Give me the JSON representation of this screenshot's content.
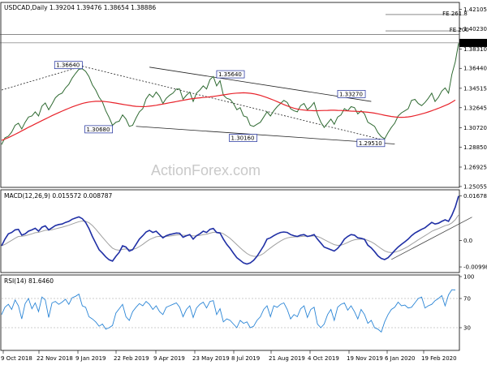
{
  "chart_data": {
    "type": "line",
    "watermark": "ActionForex.com",
    "dates": [
      "9 Oct 2018",
      "22 Nov 2018",
      "9 Jan 2019",
      "22 Feb 2019",
      "9 Apr 2019",
      "23 May 2019",
      "8 Jul 2019",
      "21 Aug 2019",
      "4 Oct 2019",
      "19 Nov 2019",
      "6 Jan 2020",
      "19 Feb 2020"
    ],
    "price": {
      "header": "USDCAD,Daily  1.39204 1.39476 1.38654 1.38886",
      "ylim": [
        1.2505,
        1.4271
      ],
      "yticks": [
        "1.42105",
        "1.40230",
        "1.38310",
        "1.36440",
        "1.34515",
        "1.32645",
        "1.30720",
        "1.28850",
        "1.26925",
        "1.25055"
      ],
      "last_price": "1.38886",
      "series": [
        {
          "values": [
            1.291,
            1.2975,
            1.299,
            1.303,
            1.3095,
            1.3115,
            1.306,
            1.3125,
            1.3175,
            1.3185,
            1.3225,
            1.3185,
            1.328,
            1.331,
            1.3245,
            1.33,
            1.336,
            1.339,
            1.3405,
            1.3455,
            1.349,
            1.355,
            1.3595,
            1.3635,
            1.364,
            1.3615,
            1.3565,
            1.3485,
            1.3435,
            1.3365,
            1.332,
            1.3235,
            1.317,
            1.3095,
            1.3125,
            1.3135,
            1.3195,
            1.3155,
            1.3085,
            1.3095,
            1.3165,
            1.3225,
            1.3255,
            1.335,
            1.3395,
            1.3365,
            1.3415,
            1.3375,
            1.3305,
            1.3355,
            1.3385,
            1.3405,
            1.3445,
            1.3445,
            1.3345,
            1.3385,
            1.3415,
            1.3325,
            1.3405,
            1.3435,
            1.3475,
            1.3445,
            1.3535,
            1.3565,
            1.3475,
            1.3525,
            1.3385,
            1.3355,
            1.3345,
            1.3305,
            1.3245,
            1.3265,
            1.3185,
            1.3175,
            1.3095,
            1.3085,
            1.3105,
            1.3125,
            1.3175,
            1.3225,
            1.3185,
            1.3235,
            1.3275,
            1.3305,
            1.3335,
            1.3315,
            1.3255,
            1.3235,
            1.3225,
            1.3285,
            1.3305,
            1.3245,
            1.3275,
            1.3315,
            1.3205,
            1.3125,
            1.3075,
            1.3115,
            1.3155,
            1.3105,
            1.3175,
            1.3195,
            1.3255,
            1.3235,
            1.3275,
            1.3265,
            1.3205,
            1.3235,
            1.3205,
            1.3125,
            1.3105,
            1.3085,
            1.3025,
            1.2985,
            1.2965,
            1.3025,
            1.3075,
            1.3115,
            1.3185,
            1.3215,
            1.3235,
            1.3255,
            1.3335,
            1.3345,
            1.3305,
            1.3285,
            1.3315,
            1.3355,
            1.3405,
            1.3325,
            1.3365,
            1.3425,
            1.3455,
            1.3405,
            1.3585,
            1.3705,
            1.3885
          ],
          "color": "#2f6a32",
          "kind": "price"
        },
        {
          "values": [
            1.295,
            1.2962,
            1.2976,
            1.2992,
            1.3008,
            1.3024,
            1.3042,
            1.3058,
            1.3076,
            1.3092,
            1.3108,
            1.3124,
            1.314,
            1.3156,
            1.3172,
            1.3188,
            1.3203,
            1.3218,
            1.3232,
            1.3246,
            1.3259,
            1.3272,
            1.3284,
            1.3295,
            1.3305,
            1.3313,
            1.3319,
            1.3323,
            1.3326,
            1.3327,
            1.3326,
            1.3323,
            1.3319,
            1.3314,
            1.3309,
            1.3303,
            1.3297,
            1.3292,
            1.3287,
            1.3282,
            1.3278,
            1.3276,
            1.3275,
            1.3276,
            1.3279,
            1.3283,
            1.3288,
            1.3294,
            1.33,
            1.3306,
            1.3312,
            1.3318,
            1.3324,
            1.333,
            1.3336,
            1.3342,
            1.3348,
            1.3353,
            1.3357,
            1.336,
            1.3363,
            1.3366,
            1.3369,
            1.3373,
            1.3378,
            1.3383,
            1.3388,
            1.3393,
            1.3398,
            1.3402,
            1.3405,
            1.3407,
            1.3408,
            1.3407,
            1.3404,
            1.3399,
            1.3392,
            1.3383,
            1.3373,
            1.3362,
            1.335,
            1.3337,
            1.3323,
            1.3309,
            1.3295,
            1.3282,
            1.327,
            1.326,
            1.3252,
            1.3246,
            1.3242,
            1.3239,
            1.3237,
            1.3236,
            1.3236,
            1.3237,
            1.3238,
            1.3239,
            1.324,
            1.324,
            1.3239,
            1.3238,
            1.3236,
            1.3234,
            1.3232,
            1.3231,
            1.3229,
            1.3227,
            1.3224,
            1.3221,
            1.3217,
            1.3212,
            1.3206,
            1.3199,
            1.3192,
            1.3186,
            1.318,
            1.3176,
            1.3173,
            1.3172,
            1.3173,
            1.3176,
            1.3181,
            1.3188,
            1.3196,
            1.3205,
            1.3214,
            1.3224,
            1.3235,
            1.3247,
            1.3259,
            1.3272,
            1.3286,
            1.33,
            1.3318,
            1.3338
          ],
          "color": "#e8232b",
          "kind": "ma"
        }
      ],
      "annotations": [
        {
          "text": "1.36640",
          "x": 24,
          "y": 1.3664,
          "side": "left"
        },
        {
          "text": "1.30680",
          "x": 33,
          "y": 1.3045,
          "side": "left"
        },
        {
          "text": "1.35640",
          "x": 64,
          "y": 1.3575,
          "side": "right"
        },
        {
          "text": "1.30160",
          "x": 76,
          "y": 1.2962,
          "side": "left"
        },
        {
          "text": "1.33270",
          "x": 100,
          "y": 1.3385,
          "side": "right"
        },
        {
          "text": "1.29510",
          "x": 114,
          "y": 1.2913,
          "side": "left"
        },
        {
          "text": "FE 261.8",
          "x": 140,
          "y": 1.4162,
          "side": "left",
          "plain": true
        },
        {
          "text": "FE 200",
          "x": 140,
          "y": 1.4005,
          "side": "left",
          "plain": true
        }
      ],
      "hlines": [
        1.4162,
        1.4005,
        1.3972,
        1.3889
      ],
      "trendlines": [
        {
          "x1": 0,
          "y1": 1.3435,
          "x2": 24,
          "y2": 1.3664,
          "dash": true
        },
        {
          "x1": 24,
          "y1": 1.3664,
          "x2": 114,
          "y2": 1.2951,
          "dash": true
        },
        {
          "x1": 44,
          "y1": 1.3655,
          "x2": 110,
          "y2": 1.3325,
          "dash": false
        },
        {
          "x1": 40,
          "y1": 1.3085,
          "x2": 117,
          "y2": 1.2915,
          "dash": false
        }
      ]
    },
    "macd": {
      "header": "MACD(12,26,9) 0.015572 0.008787",
      "ylim": [
        -0.0115,
        0.0185
      ],
      "yticks": [
        "0.016789",
        "0.0",
        "-0.009989"
      ],
      "macd_values": [
        -0.002,
        0.0005,
        0.0025,
        0.003,
        0.004,
        0.0042,
        0.002,
        0.0025,
        0.0035,
        0.004,
        0.0046,
        0.0035,
        0.005,
        0.0055,
        0.004,
        0.0048,
        0.0056,
        0.006,
        0.0062,
        0.0068,
        0.0072,
        0.008,
        0.0085,
        0.0089,
        0.0082,
        0.0068,
        0.0045,
        0.0015,
        -0.001,
        -0.0035,
        -0.0048,
        -0.0062,
        -0.0073,
        -0.0078,
        -0.006,
        -0.0045,
        -0.002,
        -0.0025,
        -0.004,
        -0.0035,
        -0.0015,
        0.0005,
        0.0018,
        0.0032,
        0.0038,
        0.003,
        0.0035,
        0.0022,
        0.001,
        0.0018,
        0.0022,
        0.0025,
        0.0028,
        0.0027,
        0.0012,
        0.0018,
        0.0022,
        0.0005,
        0.0018,
        0.0025,
        0.0035,
        0.003,
        0.0042,
        0.0045,
        0.003,
        0.0028,
        0.0005,
        -0.0015,
        -0.003,
        -0.0048,
        -0.0065,
        -0.0075,
        -0.0085,
        -0.0089,
        -0.0085,
        -0.0075,
        -0.006,
        -0.004,
        -0.002,
        0.0005,
        0.001,
        0.0018,
        0.0025,
        0.003,
        0.0032,
        0.003,
        0.0022,
        0.0018,
        0.0015,
        0.002,
        0.0022,
        0.0015,
        0.0018,
        0.0022,
        0.0005,
        -0.001,
        -0.0025,
        -0.003,
        -0.0035,
        -0.004,
        -0.003,
        -0.0015,
        0.0005,
        0.0015,
        0.0022,
        0.002,
        0.001,
        0.0008,
        0.0004,
        -0.0018,
        -0.0028,
        -0.0042,
        -0.0058,
        -0.0068,
        -0.0072,
        -0.0065,
        -0.0052,
        -0.0038,
        -0.0025,
        -0.0015,
        -0.0005,
        0.0005,
        0.0018,
        0.0028,
        0.0035,
        0.0042,
        0.0048,
        0.0058,
        0.0068,
        0.0062,
        0.0065,
        0.0072,
        0.0078,
        0.0072,
        0.0095,
        0.0126,
        0.016789
      ],
      "colors": {
        "macd": "#1f2fa5",
        "signal": "#a0a0a0",
        "trend": "#444444"
      },
      "trendline": {
        "x1": 116,
        "y1": -0.0072,
        "x2": 140,
        "y2": 0.0088
      }
    },
    "rsi": {
      "header": "RSI(14) 81.6460",
      "ylim": [
        0,
        100
      ],
      "yticks": [
        "100",
        "70",
        "30",
        "0"
      ],
      "values": [
        48,
        58,
        62,
        55,
        68,
        60,
        42,
        63,
        70,
        56,
        64,
        52,
        72,
        68,
        44,
        64,
        66,
        62,
        65,
        69,
        62,
        71,
        73,
        76,
        60,
        58,
        45,
        42,
        38,
        32,
        35,
        28,
        30,
        33,
        50,
        56,
        62,
        45,
        40,
        52,
        58,
        63,
        60,
        66,
        62,
        55,
        60,
        52,
        48,
        58,
        60,
        62,
        64,
        58,
        45,
        55,
        60,
        44,
        57,
        62,
        65,
        57,
        66,
        67,
        48,
        56,
        38,
        42,
        40,
        35,
        30,
        40,
        36,
        38,
        30,
        32,
        40,
        45,
        55,
        60,
        45,
        60,
        58,
        62,
        64,
        55,
        42,
        48,
        45,
        56,
        60,
        44,
        55,
        58,
        35,
        30,
        35,
        48,
        55,
        40,
        58,
        62,
        64,
        54,
        60,
        52,
        42,
        55,
        48,
        36,
        40,
        30,
        28,
        24,
        38,
        48,
        55,
        58,
        65,
        60,
        61,
        57,
        58,
        64,
        70,
        72,
        57,
        60,
        62,
        67,
        70,
        74,
        60,
        75,
        82,
        81.646
      ],
      "color": "#2a85d6"
    }
  }
}
